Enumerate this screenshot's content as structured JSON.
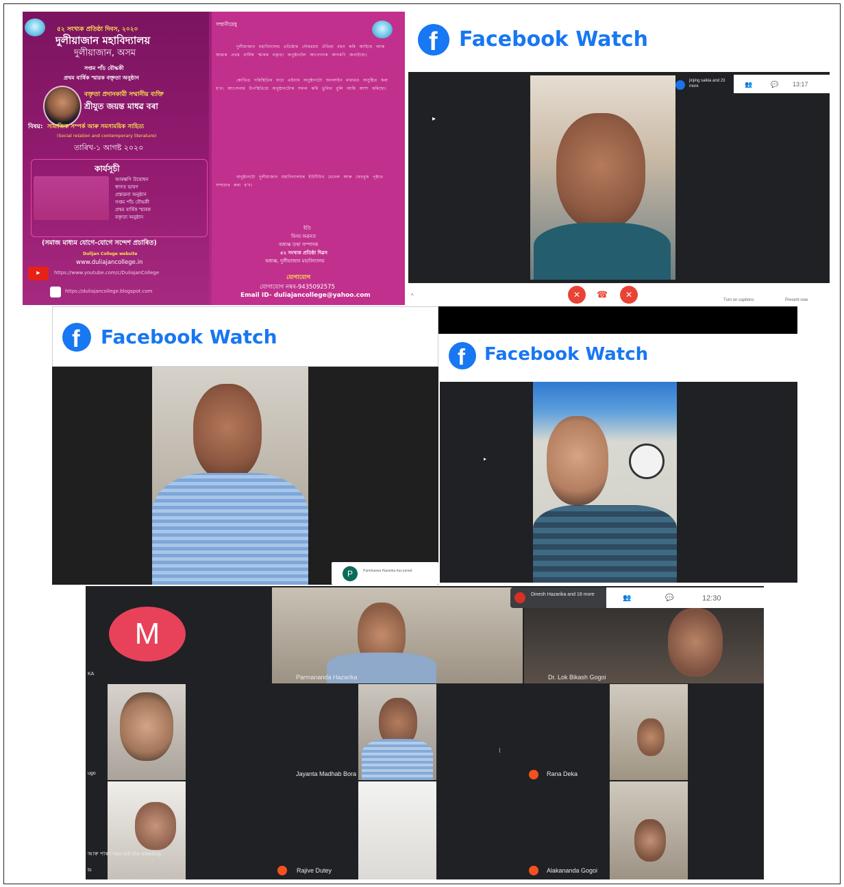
{
  "poster": {
    "line1": "৫২ সংখ্যক প্রতিষ্ঠা দিবস, ২০২০",
    "college_name": "দুলীয়াজান মহাবিদ্যালয়",
    "place": "দুলীয়াজান, অসম",
    "line_program": "সপ্তম পাঁচ বৌদ্ধকী",
    "line_program2": "প্রথম বার্ষিক স্মারক বক্তৃতা অনুষ্ঠান",
    "speaker_label": "বক্তৃতা প্রদানকারী সম্মানীয় ব্যক্তি",
    "speaker_name": "শ্ৰীযুত জয়ন্ত মাধৱ বৰা",
    "subject_label": "বিষয়:",
    "subject": "সামাজিক সম্পৰ্ক আৰু সমসাময়িক সাহিত্য",
    "subject_en": "(Social relation and contemporary literature)",
    "date": "তাৰিখ-১ আগষ্ট ২০২০",
    "agenda_title": "কাৰ্যসূচী",
    "agenda_items": [
      "আৰম্ভণি উদ্বোধন",
      "স্বাগত ভাষণ",
      "প্ৰস্তাৱনা অনুষ্ঠান",
      "সপ্তম পাঁচ বৌদ্ধকী",
      "প্ৰথম বাৰ্ষিক স্মাৰক",
      "বক্তৃতা অনুষ্ঠান"
    ],
    "social_note": "(সমাজ মাধ্যম যোগে-যোগে সন্দেশ প্ৰচাৰিত)",
    "college_website_label": "Dulijan College website",
    "website": "www.duliajancollege.in",
    "youtube": "https://www.youtube.com/c/DuliajanCollege",
    "blog": "https://duliajancollege.blogspot.com",
    "contact_label": "যোগাযোগ",
    "phone": "যোগাযোগ নম্বৰ-9435092575",
    "email": "Email ID- duliajancollege@yahoo.com",
    "greeting": "সম্মানীয়েষু",
    "para1": "দুলীয়াজান মহাবিদ্যালয় প্ৰতিষ্ঠাৰ গৌৰৱময় ঐতিহ্য বহন কৰি আহিছে আৰু আমাৰ প্ৰথম বাৰ্ষিক স্মাৰক বক্তৃতা অনুষ্ঠানলৈ আপোনাক আদৰণি জনাইছো।",
    "para2": "কোভিড পৰিস্থিতিৰ বাবে এইবাৰ অনুষ্ঠানটো অনলাইন মাধ্যমত অনুষ্ঠিত কৰা হ'ব। আপোনাৰ উপস্থিতিয়ে অনুষ্ঠানটোক সফল কৰি তুলিব বুলি আমি আশা কৰিছো।",
    "para3": "অনুষ্ঠানটো দুলীয়াজান মহাবিদ্যালয়ৰ ইউটিউব চেনেল আৰু ফেচবুক পৃষ্ঠাত সম্প্ৰচাৰ কৰা হ'ব।",
    "sign1": "ইতি",
    "sign2": "বিনয় অৱনত",
    "sign3": "অধ্যক্ষ তথা সম্পাদক",
    "sign4": "৫২ সংখ্যক প্ৰতিষ্ঠা দিৱস",
    "sign5": "অধ্যক্ষ, দুলীয়াজান মহাবিদ্যালয়"
  },
  "fb_label": "Facebook Watch",
  "window1": {
    "participants": "jinjing saikia and 23 more",
    "time": "13:17",
    "captions": "Turn on captions",
    "present": "Present now"
  },
  "window2": {
    "avatar_letter": "P",
    "participant": "Pariohaswa Hazarika has joined"
  },
  "window4": {
    "tile_letter": "M",
    "participants": "Dinesh Hazarika and 18 more",
    "time": "12:30",
    "names": [
      "Parmananda Hazarika",
      "Dr. Lok Bikash Gogoi",
      "Jayanta Madhab Bora",
      "Rana Deka",
      "Rajive Dutey",
      "Alakananda Gogoi"
    ],
    "left_msg": "আৰু পাৰণ has left the meeting",
    "side_marks": [
      "KA",
      "ugo",
      "ts"
    ]
  }
}
